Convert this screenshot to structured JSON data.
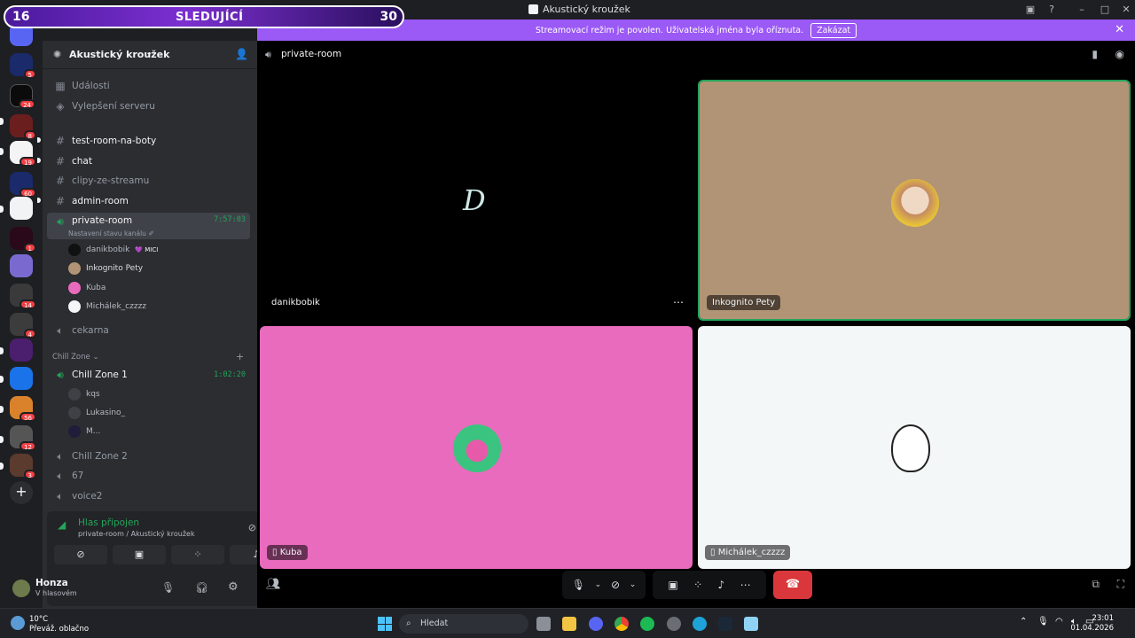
{
  "window": {
    "title": "Akustický kroužek"
  },
  "follow_overlay": {
    "left_num": "16",
    "label": "SLEDUJÍCÍ",
    "right_num": "30"
  },
  "banner": {
    "text": "Streamovací režim je povolen. Uživatelská jména byla oříznuta.",
    "button": "Zakázat"
  },
  "rail": {
    "badges": [
      "5",
      "24",
      "8",
      "19",
      "60",
      "1",
      "14",
      "4",
      "56",
      "12",
      "3"
    ]
  },
  "server": {
    "name": "Akustický kroužek"
  },
  "sidebar": {
    "events": "Události",
    "boost": "Vylepšení serveru",
    "channels": [
      {
        "name": "test-room-na-boty"
      },
      {
        "name": "chat"
      },
      {
        "name": "clipy-ze-streamu"
      },
      {
        "name": "admin-room"
      }
    ],
    "private_room": {
      "name": "private-room",
      "timer": "7:57:03",
      "status": "Nastavení stavu kanálu ✐"
    },
    "members": [
      "danikbobik",
      "Inkognito Pety",
      "Kuba",
      "Michálek_czzzz"
    ],
    "member_tag": "💜 MICI",
    "cekarna": "cekarna",
    "category": "Chill Zone ⌄",
    "chill1": {
      "name": "Chill Zone 1",
      "timer": "1:02:20"
    },
    "chill1_members": [
      "kqs",
      "Lukasino_",
      "M..."
    ],
    "chill2": "Chill Zone 2",
    "c67": "67",
    "voice2": "voice2"
  },
  "voice_panel": {
    "status": "Hlas připojen",
    "channel": "private-room / Akustický kroužek"
  },
  "user": {
    "name": "Honza",
    "status": "V hlasovém"
  },
  "main": {
    "channel": "private-room",
    "tiles": [
      {
        "name": "danikbobik",
        "bg": "#000000"
      },
      {
        "name": "Inkognito Pety",
        "bg": "#b19476"
      },
      {
        "name": "Kuba",
        "bg": "#e96bbd"
      },
      {
        "name": "Michálek_czzzz",
        "bg": "#f4f7f8"
      }
    ]
  },
  "taskbar": {
    "weather_temp": "10°C",
    "weather_desc": "Převáž. oblačno",
    "search": "Hledat",
    "time": "23:01",
    "date": "01.04.2026"
  }
}
